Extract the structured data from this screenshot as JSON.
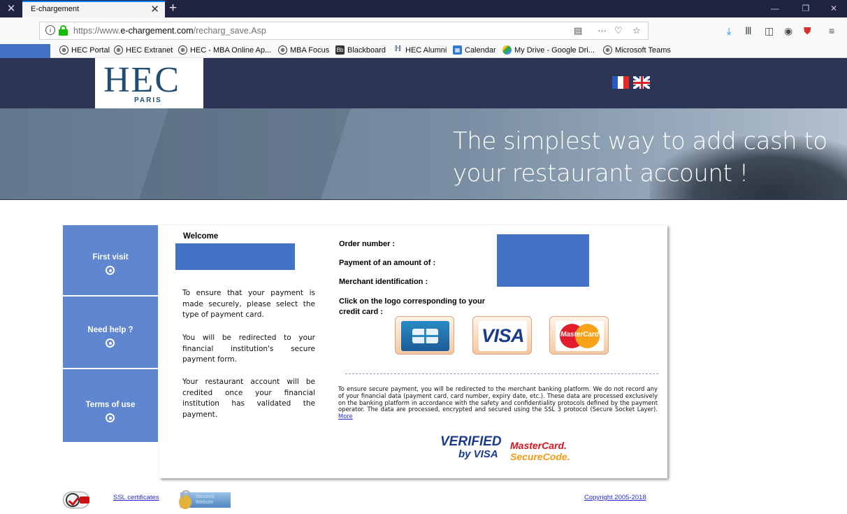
{
  "browser": {
    "tab_title": "E-chargement",
    "url_prefix": "https://www.",
    "url_domain": "e-chargement.com",
    "url_path": "/recharg_save.Asp",
    "bookmarks": [
      {
        "label": "HEC Portal",
        "icon": "globe-icon"
      },
      {
        "label": "HEC Extranet",
        "icon": "globe-icon"
      },
      {
        "label": "HEC - MBA Online Ap...",
        "icon": "globe-icon"
      },
      {
        "label": "MBA Focus",
        "icon": "globe-icon"
      },
      {
        "label": "Blackboard",
        "icon": "blackboard-icon"
      },
      {
        "label": "HEC Alumni",
        "icon": "hec-icon"
      },
      {
        "label": "Calendar",
        "icon": "calendar-icon"
      },
      {
        "label": "My Drive - Google Dri...",
        "icon": "drive-icon"
      },
      {
        "label": "Microsoft Teams",
        "icon": "globe-icon"
      }
    ]
  },
  "header": {
    "logo_main": "HEC",
    "logo_sub": "PARIS",
    "banner_text": "The simplest way to add cash to your restaurant account !"
  },
  "menu": {
    "items": [
      {
        "label": "First visit"
      },
      {
        "label": "Need help ?"
      },
      {
        "label": "Terms of use"
      }
    ]
  },
  "content": {
    "welcome": "Welcome",
    "para1": "To ensure that your payment is made securely, please select the type of payment card.",
    "para2": "You will be redirected to your financial institution's secure payment form.",
    "para3": "Your restaurant account will be credited once your financial institution has validated the payment.",
    "order_number_label": "Order number :",
    "amount_label": "Payment of an amount of :",
    "merchant_label": "Merchant identification :",
    "card_prompt": "Click on the logo corresponding to your credit card :",
    "cards": [
      "CB",
      "VISA",
      "MasterCard"
    ],
    "secure_text": "To ensure secure payment, you will be redirected to the merchant banking platform. We do not record any of your financial data (payment card, card number, expiry date, etc.). These data are processed exclusively on the banking platform in accordance with the safety and confidentiality protocols defined by the payment operator. The data are processed, encrypted and secured using the SSL 3 protocol (Secure Socket Layer).",
    "more_link": "More",
    "verified_line1": "VERIFIED",
    "verified_line2": "by VISA",
    "mc_line1": "MasterCard.",
    "mc_line2": "SecureCode."
  },
  "footer": {
    "ssl_link": "SSL certificates",
    "secured_badge": "Secured Website",
    "copyright": "Copyright 2005-2018"
  }
}
